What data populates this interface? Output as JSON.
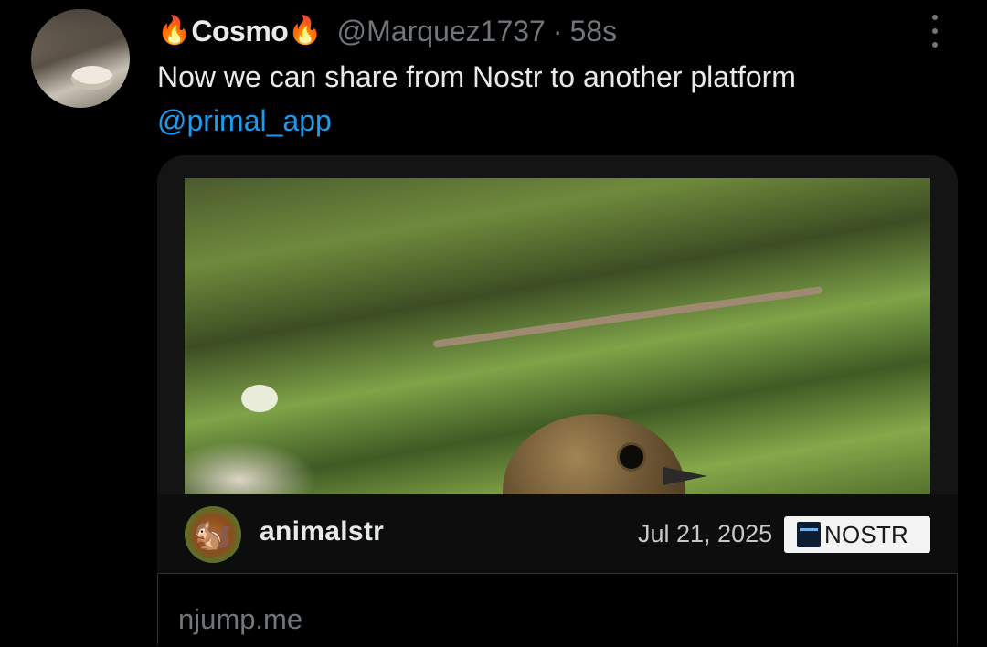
{
  "tweet": {
    "author_display_name": "Cosmo",
    "name_emoji": "🔥",
    "handle": "@Marquez1737",
    "separator": "·",
    "timestamp": "58s",
    "text": "Now we can share from Nostr to another platform",
    "mention": "@primal_app"
  },
  "card": {
    "author": "animalstr",
    "author_avatar_emoji": "🐿️",
    "date": "Jul 21, 2025",
    "platform_badge": "NOSTR",
    "domain": "njump.me"
  },
  "icons": {
    "more": "more-options-icon",
    "badge": "nostr-badge-icon"
  },
  "colors": {
    "background": "#000000",
    "text": "#e7e9ea",
    "muted": "#71767b",
    "mention": "#1d9bf0"
  }
}
